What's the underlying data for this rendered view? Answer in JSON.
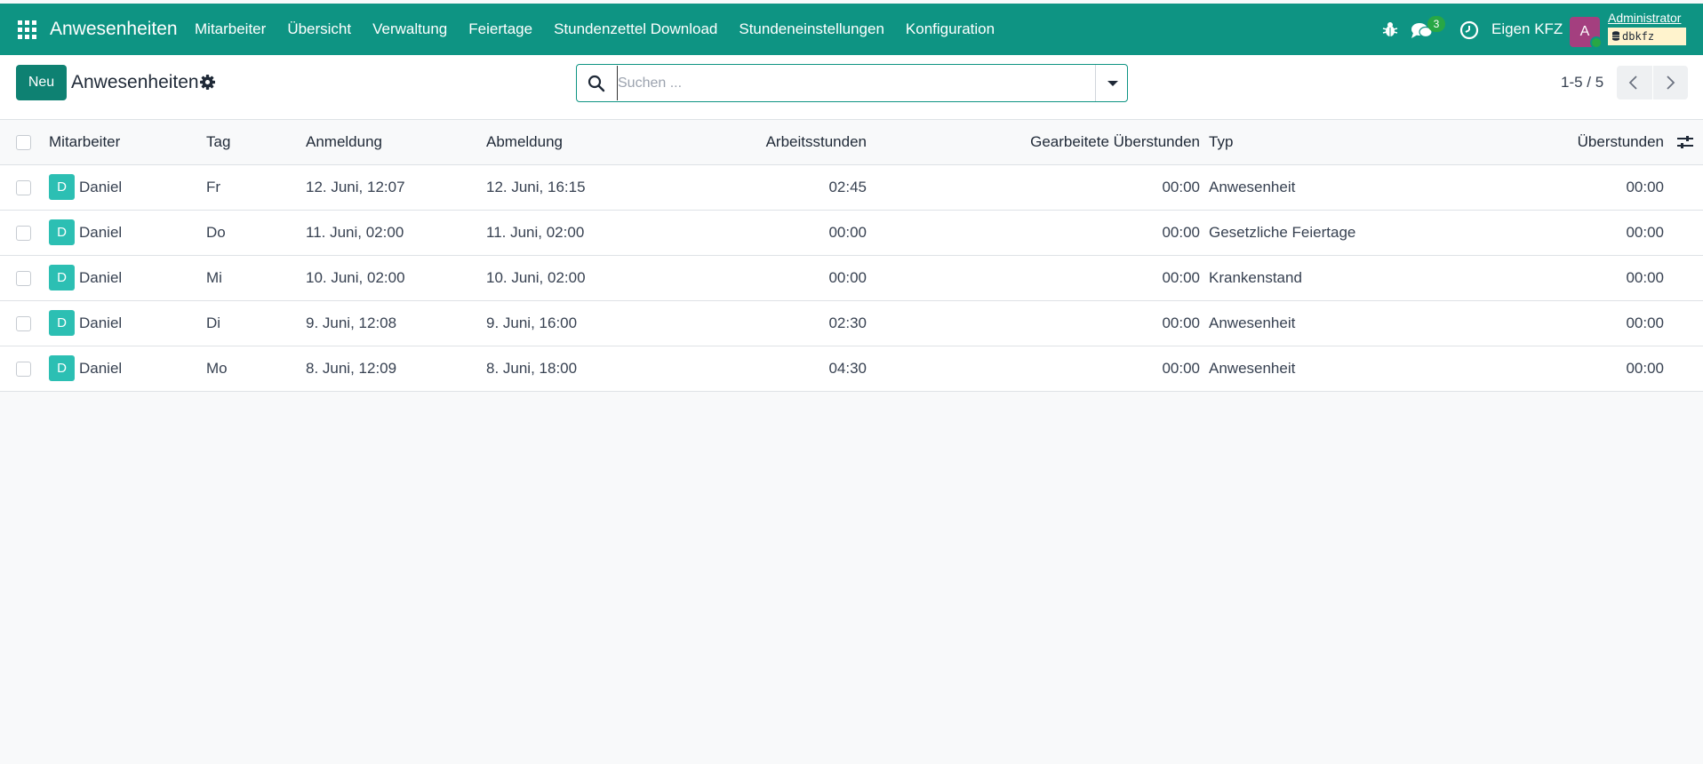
{
  "navbar": {
    "brand": "Anwesenheiten",
    "menu": [
      "Mitarbeiter",
      "Übersicht",
      "Verwaltung",
      "Feiertage",
      "Stundenzettel Download",
      "Stundeneinstellungen",
      "Konfiguration"
    ],
    "chat_count": "3",
    "company": "Eigen KFZ",
    "avatar_letter": "A",
    "user_name": "Administrator",
    "db_name": "dbkfz"
  },
  "control": {
    "new_label": "Neu",
    "title": "Anwesenheiten",
    "search_placeholder": "Suchen ...",
    "pager": "1-5 / 5"
  },
  "table": {
    "headers": {
      "employee": "Mitarbeiter",
      "day": "Tag",
      "check_in": "Anmeldung",
      "check_out": "Abmeldung",
      "work_hours": "Arbeitsstunden",
      "worked_overtime": "Gearbeitete Überstunden",
      "type": "Typ",
      "overtime": "Überstunden"
    },
    "rows": [
      {
        "avatar": "D",
        "employee": "Daniel",
        "day": "Fr",
        "check_in": "12. Juni, 12:07",
        "check_out": "12. Juni, 16:15",
        "work_hours": "02:45",
        "worked_overtime": "00:00",
        "type": "Anwesenheit",
        "overtime": "00:00"
      },
      {
        "avatar": "D",
        "employee": "Daniel",
        "day": "Do",
        "check_in": "11. Juni, 02:00",
        "check_out": "11. Juni, 02:00",
        "work_hours": "00:00",
        "worked_overtime": "00:00",
        "type": "Gesetzliche Feiertage",
        "overtime": "00:00"
      },
      {
        "avatar": "D",
        "employee": "Daniel",
        "day": "Mi",
        "check_in": "10. Juni, 02:00",
        "check_out": "10. Juni, 02:00",
        "work_hours": "00:00",
        "worked_overtime": "00:00",
        "type": "Krankenstand",
        "overtime": "00:00"
      },
      {
        "avatar": "D",
        "employee": "Daniel",
        "day": "Di",
        "check_in": "9. Juni, 12:08",
        "check_out": "9. Juni, 16:00",
        "work_hours": "02:30",
        "worked_overtime": "00:00",
        "type": "Anwesenheit",
        "overtime": "00:00"
      },
      {
        "avatar": "D",
        "employee": "Daniel",
        "day": "Mo",
        "check_in": "8. Juni, 12:09",
        "check_out": "8. Juni, 18:00",
        "work_hours": "04:30",
        "worked_overtime": "00:00",
        "type": "Anwesenheit",
        "overtime": "00:00"
      }
    ]
  },
  "colors": {
    "navbar": "#0e9483",
    "primary_button": "#0e8172",
    "employee_avatar": "#2cbfb3",
    "user_avatar": "#a43f7f",
    "badge_green": "#28a745",
    "db_badge": "#fff3cd"
  }
}
